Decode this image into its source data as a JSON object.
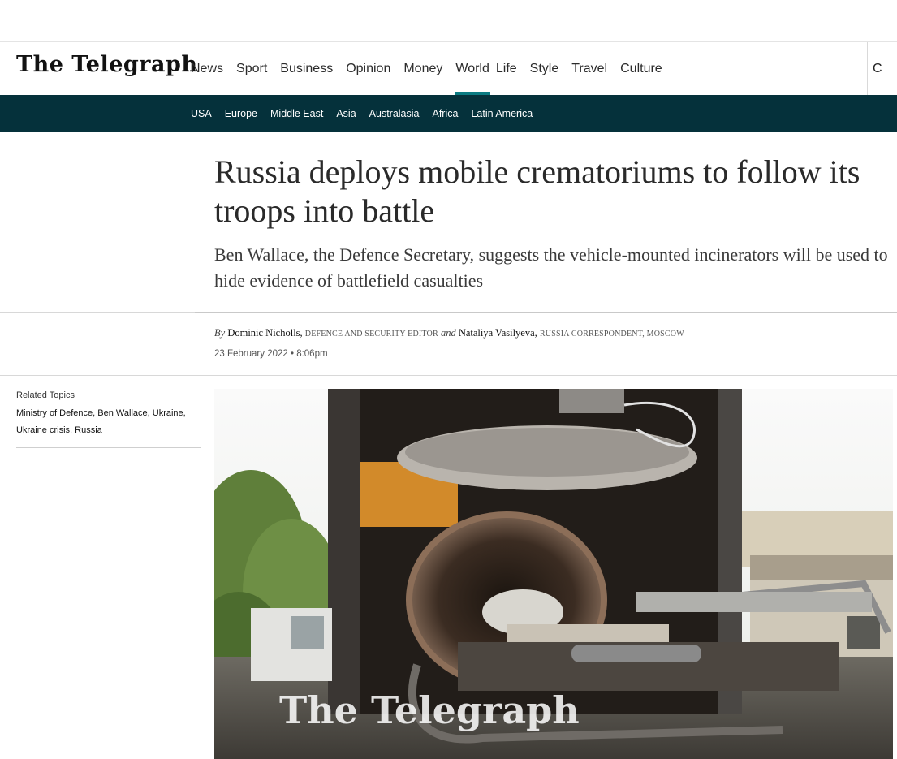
{
  "masthead": {
    "logo_text": "The Telegraph",
    "nav": [
      "News",
      "Sport",
      "Business",
      "Opinion",
      "Money",
      "World",
      "Life",
      "Style",
      "Travel",
      "Culture"
    ],
    "active_nav": "World",
    "account_glyph": "C"
  },
  "subnav": [
    "USA",
    "Europe",
    "Middle East",
    "Asia",
    "Australasia",
    "Africa",
    "Latin America"
  ],
  "article": {
    "headline": "Russia deploys mobile crematoriums to follow its troops into battle",
    "standfirst": "Ben Wallace, the Defence Secretary, suggests the vehicle-mounted incinerators will be used to hide evidence of battlefield casualties",
    "byline": {
      "by": "By",
      "author1": "Dominic Nicholls,",
      "role1": "DEFENCE AND SECURITY EDITOR",
      "and": "and",
      "author2": "Nataliya Vasilyeva,",
      "role2": "RUSSIA CORRESPONDENT, MOSCOW"
    },
    "date": "23 February 2022 • 8:06pm",
    "image_watermark": "The Telegraph"
  },
  "related": {
    "title": "Related Topics",
    "topics": [
      "Ministry of Defence",
      "Ben Wallace",
      "Ukraine",
      "Ukraine crisis",
      "Russia"
    ]
  },
  "colors": {
    "subnav_bg": "#05313b",
    "active_underline": "#0b7b82"
  }
}
